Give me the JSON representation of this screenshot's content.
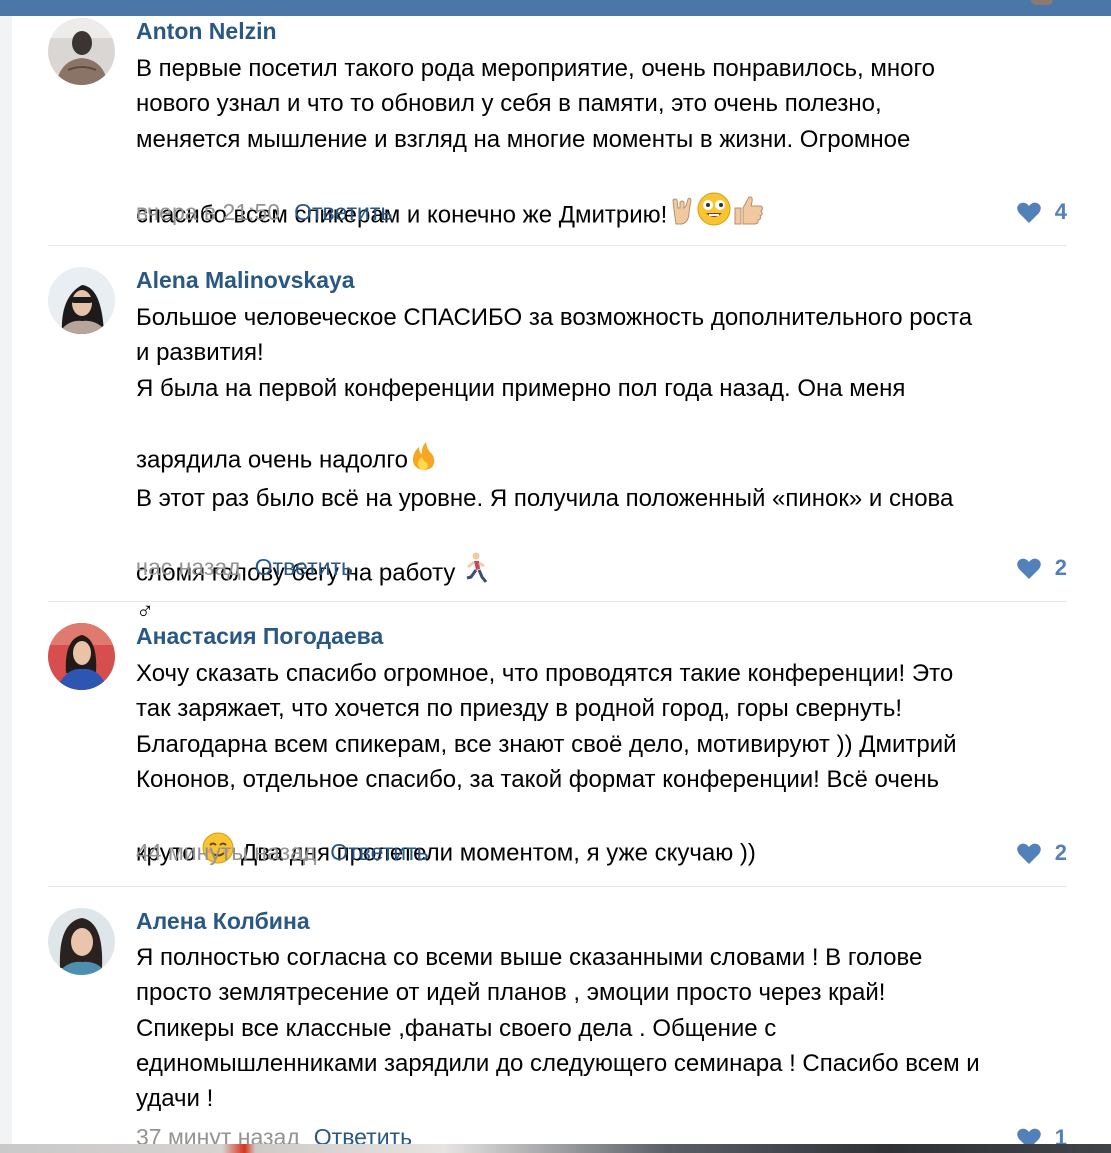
{
  "theme": {
    "accent": "#4a76a8",
    "link": "#2a5885",
    "muted": "#939393",
    "like": "#5181b8"
  },
  "comments": [
    {
      "author": "Anton Nelzin",
      "text": "В первые посетил такого рода мероприятие, очень понравилось, много\nнового узнал и что то обновил у себя в памяти, это очень полезно,\nменяется мышление и взгляд на многие моменты в жизни. Огромное\nспасибо всем спикерам и конечно же Дмитрию!",
      "emojis": [
        "rock-hand-emoji",
        "crazy-face-emoji",
        "thumbs-up-emoji"
      ],
      "time": "вчера в 21:50",
      "reply_label": "Ответить",
      "likes": "4"
    },
    {
      "author": "Alena Malinovskaya",
      "text_1": "Большое человеческое СПАСИБО за возможность дополнительного роста\nи развития!\nЯ была на первой конференции примерно пол года назад. Она меня\nзарядила очень надолго",
      "emoji_1": "fire-emoji",
      "text_2": "В этот раз было всё на уровне. Я получила положенный «пинок» и снова\nсломя голову бегу на работу",
      "emoji_2": "runner-emoji",
      "text_3": "♂",
      "time": "час назад",
      "reply_label": "Ответить",
      "likes": "2"
    },
    {
      "author": "Анастасия Погодаева",
      "text_1": "Хочу сказать спасибо огромное, что проводятся такие конференции! Это\nтак заряжает, что хочется по приезду в родной город, горы свернуть!\nБлагодарна всем спикерам, все знают своё дело, мотивируют )) Дмитрий\nКононов, отдельное спасибо, за такой формат конференции! Всё очень\nкруто",
      "emoji_1": "smiling-face-emoji",
      "text_2": "Два дня пролетели моментом, я уже скучаю ))",
      "time": "44 минуты назад",
      "reply_label": "Ответить",
      "likes": "2"
    },
    {
      "author": "Алена Колбина",
      "text": "Я полностью согласна со всеми выше сказанными словами ! В голове\nпросто землятресение от идей планов , эмоции просто через край!\nСпикеры все классные ,фанаты своего дела . Общение с\nединомышленниками зарядили до следующего семинара ! Спасибо всем и\nудачи !",
      "time": "37 минут назад",
      "reply_label": "Ответить",
      "likes": "1"
    }
  ]
}
